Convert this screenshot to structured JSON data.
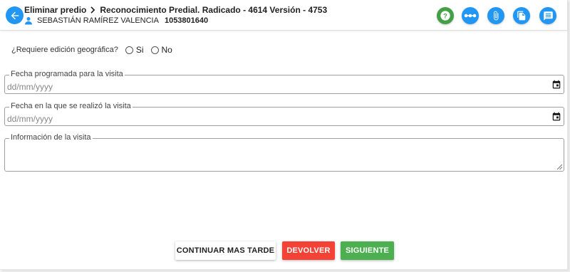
{
  "header": {
    "breadcrumb": [
      "Eliminar predio",
      "Reconocimiento Predial. Radicado - 4614 Versión - 4753"
    ],
    "user_name": "SEBASTIÁN RAMÍREZ VALENCIA",
    "user_id": "1053801640",
    "toolbar_icons": [
      "help-icon",
      "workflow-icon",
      "attachment-icon",
      "documents-icon",
      "notes-icon"
    ],
    "colors": {
      "primary": "#2196f3",
      "help": "#43a047"
    }
  },
  "form": {
    "geo_question": "¿Requiere edición geográfica?",
    "geo_options": [
      "Si",
      "No"
    ],
    "fields": [
      {
        "label": "Fecha programada para la visita",
        "placeholder": "dd/mm/yyyy"
      },
      {
        "label": "Fecha en la que se realizó la visita",
        "placeholder": "dd/mm/yyyy"
      },
      {
        "label": "Información de la visita",
        "placeholder": ""
      }
    ]
  },
  "actions": {
    "continue_later": "CONTINUAR MAS TARDE",
    "return": "DEVOLVER",
    "next": "SIGUIENTE",
    "colors": {
      "return": "#f44336",
      "next": "#4caf50"
    }
  }
}
